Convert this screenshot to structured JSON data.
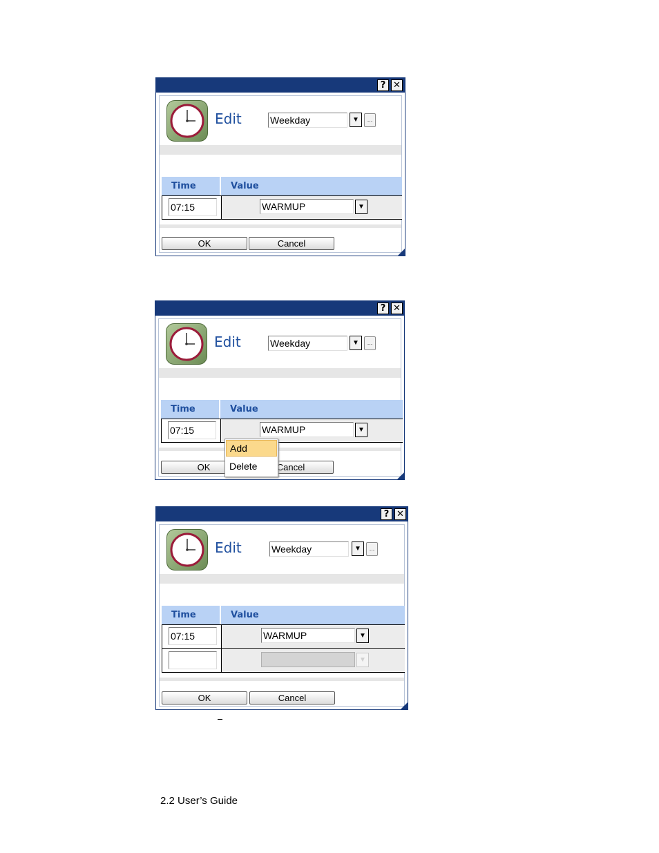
{
  "dialog": {
    "help_button": "?",
    "close_button": "✕",
    "title": "Edit",
    "schedule_value": "Weekday",
    "dropdown_arrow": "▼",
    "ellipsis": "...",
    "col_time": "Time",
    "col_value": "Value",
    "row1_time": "07:15",
    "row1_value": "WARMUP",
    "ok_label": "OK",
    "cancel_label": "Cancel"
  },
  "context_menu": {
    "items": [
      "Add",
      "Delete"
    ],
    "highlighted": "Add"
  },
  "colors": {
    "titlebar": "#17397a",
    "header_row": "#b9d2f5",
    "title_text": "#1f4f9e",
    "menu_highlight": "#fbd98c"
  },
  "icons": [
    "help-icon",
    "close-icon",
    "clock-icon",
    "dropdown-arrow-icon"
  ],
  "footer": {
    "text": "2.2 User’s Guide"
  }
}
